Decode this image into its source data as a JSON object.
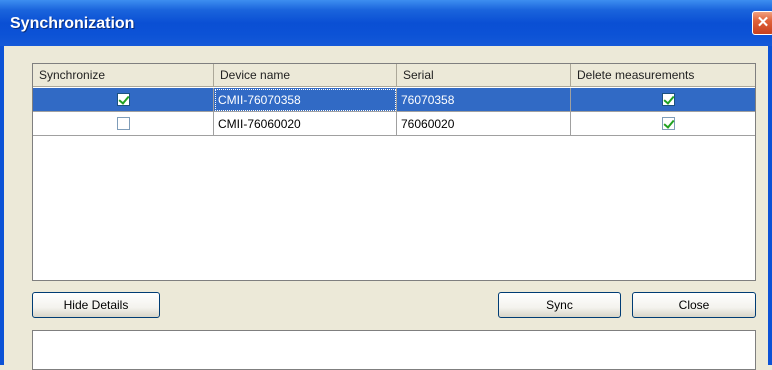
{
  "window": {
    "title": "Synchronization",
    "close_glyph": "✕"
  },
  "grid": {
    "columns": [
      "Synchronize",
      "Device name",
      "Serial",
      "Delete measurements"
    ],
    "rows": [
      {
        "synchronize": true,
        "device_name": "CMII-76070358",
        "serial": "76070358",
        "delete_measurements": true,
        "selected": true
      },
      {
        "synchronize": false,
        "device_name": "CMII-76060020",
        "serial": "76060020",
        "delete_measurements": true,
        "selected": false
      }
    ]
  },
  "buttons": {
    "hide_details": "Hide Details",
    "sync": "Sync",
    "close": "Close"
  },
  "colors": {
    "title_bar": "#0c52d6",
    "selection": "#316ac5",
    "dialog_bg": "#ece9d8"
  }
}
